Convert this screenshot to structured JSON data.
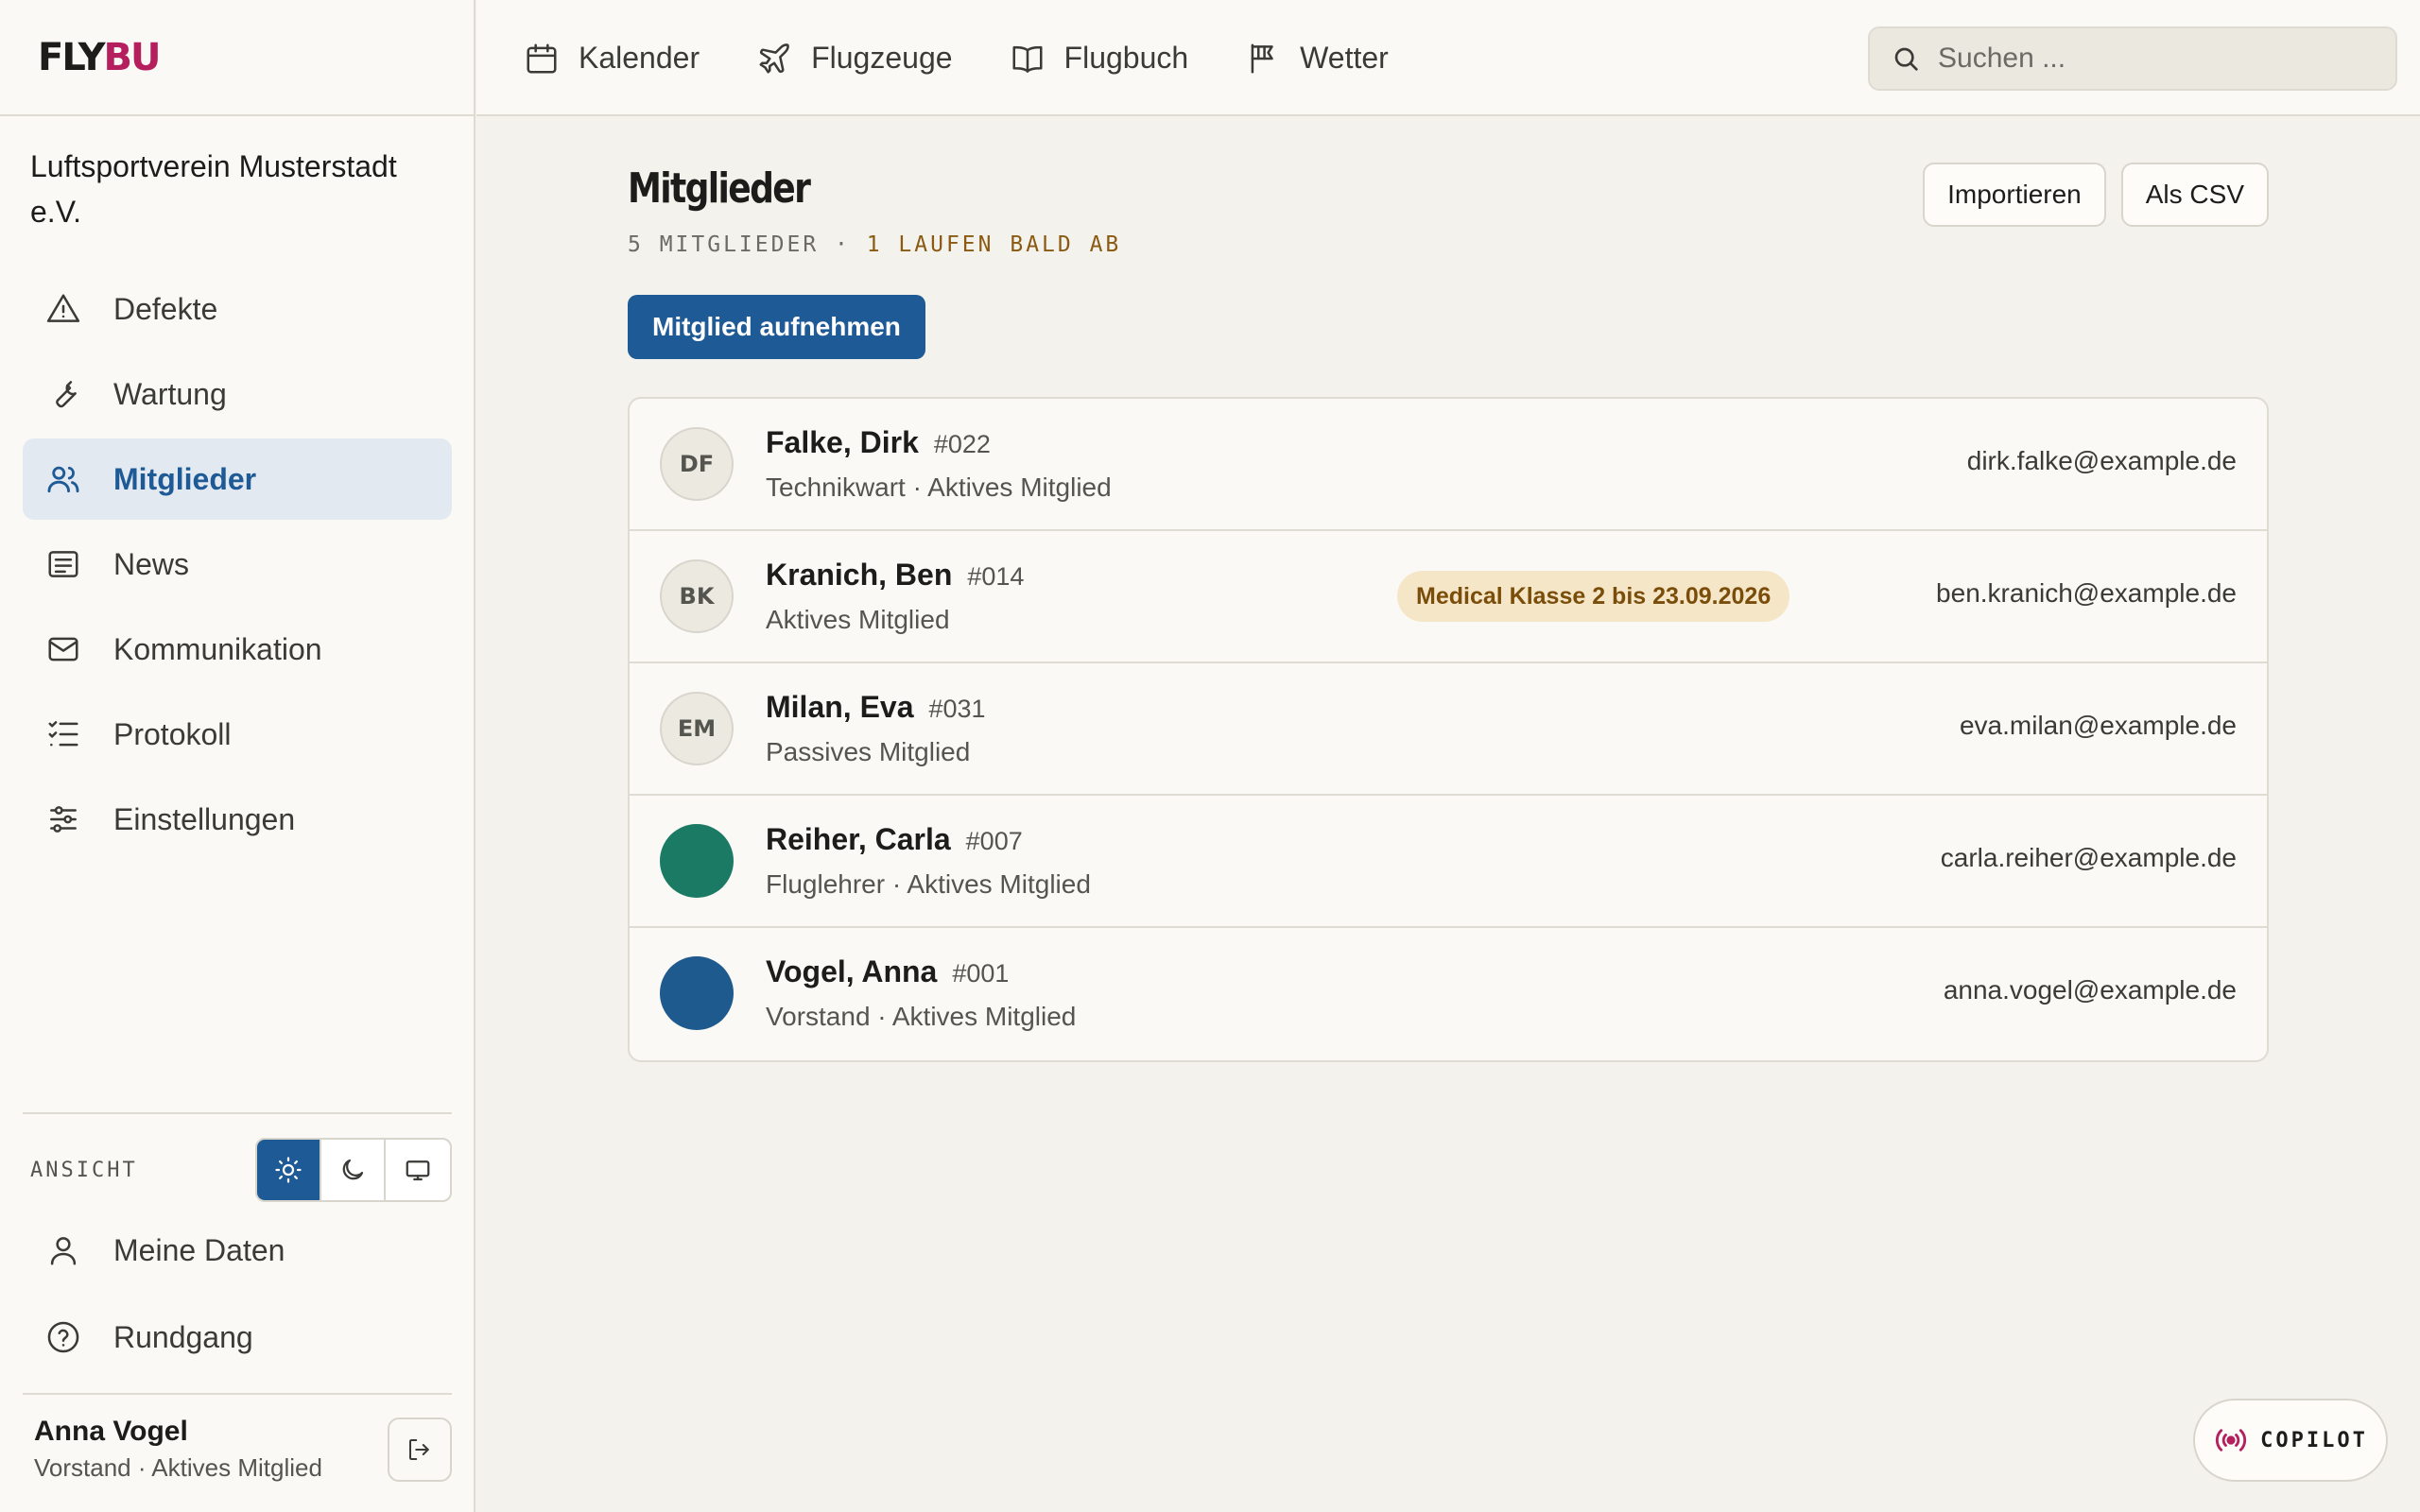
{
  "logo": {
    "part1": "FLY",
    "part2": "BU"
  },
  "club_name": "Luftsportverein Musterstadt e.V.",
  "sidebar": {
    "items": [
      {
        "label": "Defekte",
        "icon": "warning-icon"
      },
      {
        "label": "Wartung",
        "icon": "wrench-icon"
      },
      {
        "label": "Mitglieder",
        "icon": "users-icon",
        "active": true
      },
      {
        "label": "News",
        "icon": "news-icon"
      },
      {
        "label": "Kommunikation",
        "icon": "mail-icon"
      },
      {
        "label": "Protokoll",
        "icon": "list-icon"
      },
      {
        "label": "Einstellungen",
        "icon": "sliders-icon"
      }
    ],
    "view_label": "ANSICHT",
    "theme_options": [
      "light",
      "dark",
      "system"
    ],
    "theme_selected": "light",
    "bottom_items": [
      {
        "label": "Meine Daten",
        "icon": "user-icon"
      },
      {
        "label": "Rundgang",
        "icon": "help-icon"
      }
    ],
    "user": {
      "name": "Anna Vogel",
      "role": "Vorstand · Aktives Mitglied"
    }
  },
  "topnav": [
    {
      "label": "Kalender",
      "icon": "calendar-icon"
    },
    {
      "label": "Flugzeuge",
      "icon": "plane-icon"
    },
    {
      "label": "Flugbuch",
      "icon": "book-icon"
    },
    {
      "label": "Wetter",
      "icon": "flag-icon"
    }
  ],
  "search": {
    "placeholder": "Suchen ..."
  },
  "page": {
    "title": "Mitglieder",
    "subtitle_count": "5 MITGLIEDER",
    "subtitle_sep": " · ",
    "subtitle_warn": "1 LAUFEN BALD AB",
    "import_label": "Importieren",
    "csv_label": "Als CSV",
    "add_label": "Mitglied aufnehmen"
  },
  "members": [
    {
      "name": "Falke, Dirk",
      "number": "#022",
      "role": "Technikwart · Aktives Mitglied",
      "email": "dirk.falke@example.de",
      "initials": "DF",
      "avatar_color": "",
      "badge": ""
    },
    {
      "name": "Kranich, Ben",
      "number": "#014",
      "role": "Aktives Mitglied",
      "email": "ben.kranich@example.de",
      "initials": "BK",
      "avatar_color": "",
      "badge": "Medical Klasse 2 bis 23.09.2026"
    },
    {
      "name": "Milan, Eva",
      "number": "#031",
      "role": "Passives Mitglied",
      "email": "eva.milan@example.de",
      "initials": "EM",
      "avatar_color": "",
      "badge": ""
    },
    {
      "name": "Reiher, Carla",
      "number": "#007",
      "role": "Fluglehrer · Aktives Mitglied",
      "email": "carla.reiher@example.de",
      "initials": "",
      "avatar_color": "#1a7a63",
      "badge": ""
    },
    {
      "name": "Vogel, Anna",
      "number": "#001",
      "role": "Vorstand · Aktives Mitglied",
      "email": "anna.vogel@example.de",
      "initials": "",
      "avatar_color": "#1e5a8e",
      "badge": ""
    }
  ],
  "copilot": {
    "label": "COPILOT",
    "icon": "broadcast-icon"
  },
  "colors": {
    "accent": "#1e5a96",
    "brand": "#b51f5e",
    "warning_text": "#8a5a12",
    "badge_bg": "#f6e6c8"
  }
}
